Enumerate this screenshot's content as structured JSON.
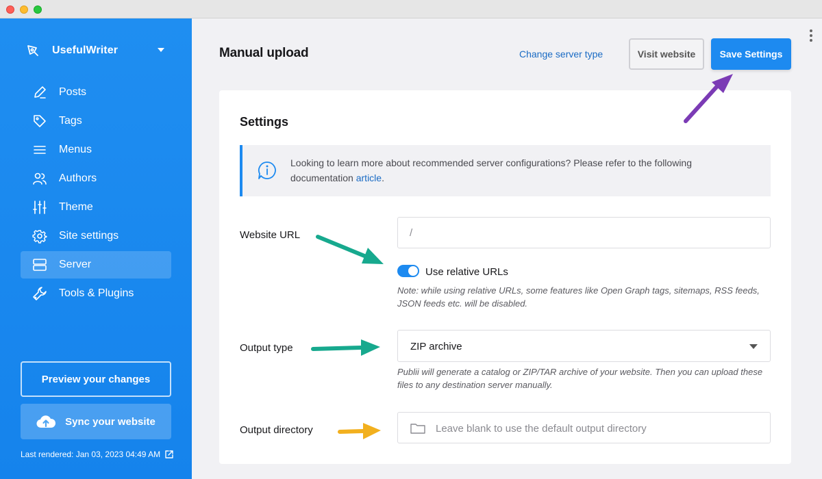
{
  "colors": {
    "sidebar": "#1f8ef1",
    "accent": "#1d8af0",
    "link": "#1a6bc4",
    "arrow_purple": "#7b3bb5",
    "arrow_teal": "#17a98e",
    "arrow_yellow": "#f2b01e"
  },
  "sidebar": {
    "site_name": "UsefulWriter",
    "items": [
      {
        "label": "Posts",
        "icon": "pencil-icon"
      },
      {
        "label": "Tags",
        "icon": "tag-icon"
      },
      {
        "label": "Menus",
        "icon": "menu-icon"
      },
      {
        "label": "Authors",
        "icon": "users-icon"
      },
      {
        "label": "Theme",
        "icon": "sliders-icon"
      },
      {
        "label": "Site settings",
        "icon": "gear-icon"
      },
      {
        "label": "Server",
        "icon": "server-icon",
        "active": true
      },
      {
        "label": "Tools & Plugins",
        "icon": "wrench-icon"
      }
    ],
    "preview_label": "Preview your changes",
    "sync_label": "Sync your website",
    "last_rendered": "Last rendered: Jan 03, 2023 04:49 AM"
  },
  "header": {
    "title": "Manual upload",
    "change_server_label": "Change server type",
    "visit_label": "Visit website",
    "save_label": "Save Settings"
  },
  "settings": {
    "title": "Settings",
    "info_text": "Looking to learn more about recommended server configurations? Please refer to the following documentation ",
    "info_link": "article",
    "info_end": ".",
    "website_url_label": "Website URL",
    "website_url_value": "/",
    "relative_urls_label": "Use relative URLs",
    "relative_urls_on": true,
    "relative_note": "Note: while using relative URLs, some features like Open Graph tags, sitemaps, RSS feeds, JSON feeds etc. will be disabled.",
    "output_type_label": "Output type",
    "output_type_value": "ZIP archive",
    "output_note": "Publii will generate a catalog or ZIP/TAR archive of your website. Then you can upload these files to any destination server manually.",
    "output_dir_label": "Output directory",
    "output_dir_placeholder": "Leave blank to use the default output directory"
  }
}
